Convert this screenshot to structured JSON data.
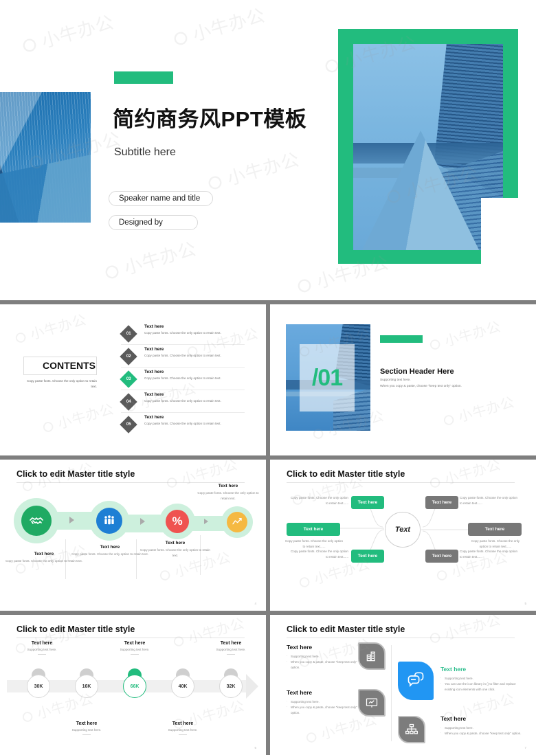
{
  "deck": {
    "accent_green": "#22bc7e",
    "accent_blue": "#2196f3",
    "accent_red": "#ef5350",
    "accent_orange": "#f5b942",
    "accent_gray": "#777777"
  },
  "cover": {
    "title": "简约商务风PPT模板",
    "subtitle": "Subtitle here",
    "speaker_pill": "Speaker name and title",
    "designer_pill": "Designed by"
  },
  "contents": {
    "heading": "CONTENTS",
    "description": "Copy paste fonts. Choose the only option to retain text.",
    "items": [
      {
        "num": "01",
        "heading": "Text here",
        "body": "Copy paste fonts. Choose the only option to retain text.",
        "active": false
      },
      {
        "num": "02",
        "heading": "Text here",
        "body": "Copy paste fonts. Choose the only option to retain text.",
        "active": false
      },
      {
        "num": "03",
        "heading": "Text here",
        "body": "Copy paste fonts. Choose the only option to retain text.",
        "active": true
      },
      {
        "num": "04",
        "heading": "Text here",
        "body": "Copy paste fonts. Choose the only option to retain text.",
        "active": false
      },
      {
        "num": "05",
        "heading": "Text here",
        "body": "Copy paste fonts. Choose the only option to retain text.",
        "active": false
      }
    ]
  },
  "section": {
    "number": "/01",
    "heading": "Section Header Here",
    "support_line1": "Supporting text here.",
    "support_line2": "When you copy & paste, choose \"keep text only\" option."
  },
  "process": {
    "title": "Click to edit Master title style",
    "page": "4",
    "steps": [
      {
        "icon": "handshake-icon",
        "color": "#1faa63",
        "heading": "Text here",
        "body": "Copy paste fonts. Choose the only option to retain text."
      },
      {
        "icon": "people-group-icon",
        "color": "#1e7fd4",
        "heading": "Text here",
        "body": "Copy paste fonts. Choose the only option to retain text."
      },
      {
        "icon": "percent-icon",
        "color": "#ef5350",
        "heading": "Text here",
        "body": "Copy paste fonts. Choose the only option to retain text."
      },
      {
        "icon": "line-chart-icon",
        "color": "#f5b942",
        "heading": "Text here",
        "body": "Copy paste fonts. Choose the only option to retain text."
      }
    ]
  },
  "mindmap": {
    "title": "Click to edit Master title style",
    "page": "5",
    "hub": "Text",
    "left": [
      {
        "tag": "Text here",
        "body": "Copy paste fonts. Choose the only option to retain text......"
      },
      {
        "tag": "Text here",
        "body": "Copy paste fonts. Choose the only option to retain text......"
      },
      {
        "tag": "Text here",
        "body": "Copy paste fonts. Choose the only option to retain text......"
      }
    ],
    "right": [
      {
        "tag": "Text here",
        "body": "Copy paste fonts. Choose the only option to retain text......"
      },
      {
        "tag": "Text here",
        "body": "Copy paste fonts. Choose the only option to retain text......"
      },
      {
        "tag": "Text here",
        "body": "Copy paste fonts. Choose the only option to retain text......"
      }
    ]
  },
  "timeline": {
    "title": "Click to edit Master title style",
    "page": "6",
    "stops": [
      {
        "value": "30K",
        "heading": "Text here",
        "support": "Supporting text here.",
        "position": "top",
        "active": false
      },
      {
        "value": "16K",
        "heading": "Text here",
        "support": "Supporting text here.",
        "position": "bottom",
        "active": false
      },
      {
        "value": "66K",
        "heading": "Text here",
        "support": "Supporting text here.",
        "position": "top",
        "active": true
      },
      {
        "value": "40K",
        "heading": "Text here",
        "support": "Supporting text here.",
        "position": "bottom",
        "active": false
      },
      {
        "value": "32K",
        "heading": "Text here",
        "support": "Supporting text here.",
        "position": "top",
        "active": false
      }
    ]
  },
  "iconlist": {
    "title": "Click to edit Master title style",
    "page": "7",
    "blocks": [
      {
        "icon": "buildings-icon",
        "heading": "Text here",
        "bullets": [
          "Supporting text here.",
          "When you copy & paste, choose \"keep text only\" option."
        ],
        "highlight": false
      },
      {
        "icon": "presentation-icon",
        "heading": "Text here",
        "bullets": [
          "Supporting text here.",
          "When you copy & paste, choose \"keep text only\" option."
        ],
        "highlight": false
      },
      {
        "icon": "chat-bubbles-icon",
        "heading": "Text here",
        "bullets": [
          "Supporting text here.",
          "You can use the icon library in  () to filter and replace existing icon elements with one click."
        ],
        "highlight": true
      },
      {
        "icon": "org-chart-icon",
        "heading": "Text here",
        "bullets": [
          "Supporting text here.",
          "When you copy & paste, choose \"keep text only\" option."
        ],
        "highlight": false
      }
    ]
  },
  "watermark": {
    "glyph": "⭘ 小牛办公"
  }
}
